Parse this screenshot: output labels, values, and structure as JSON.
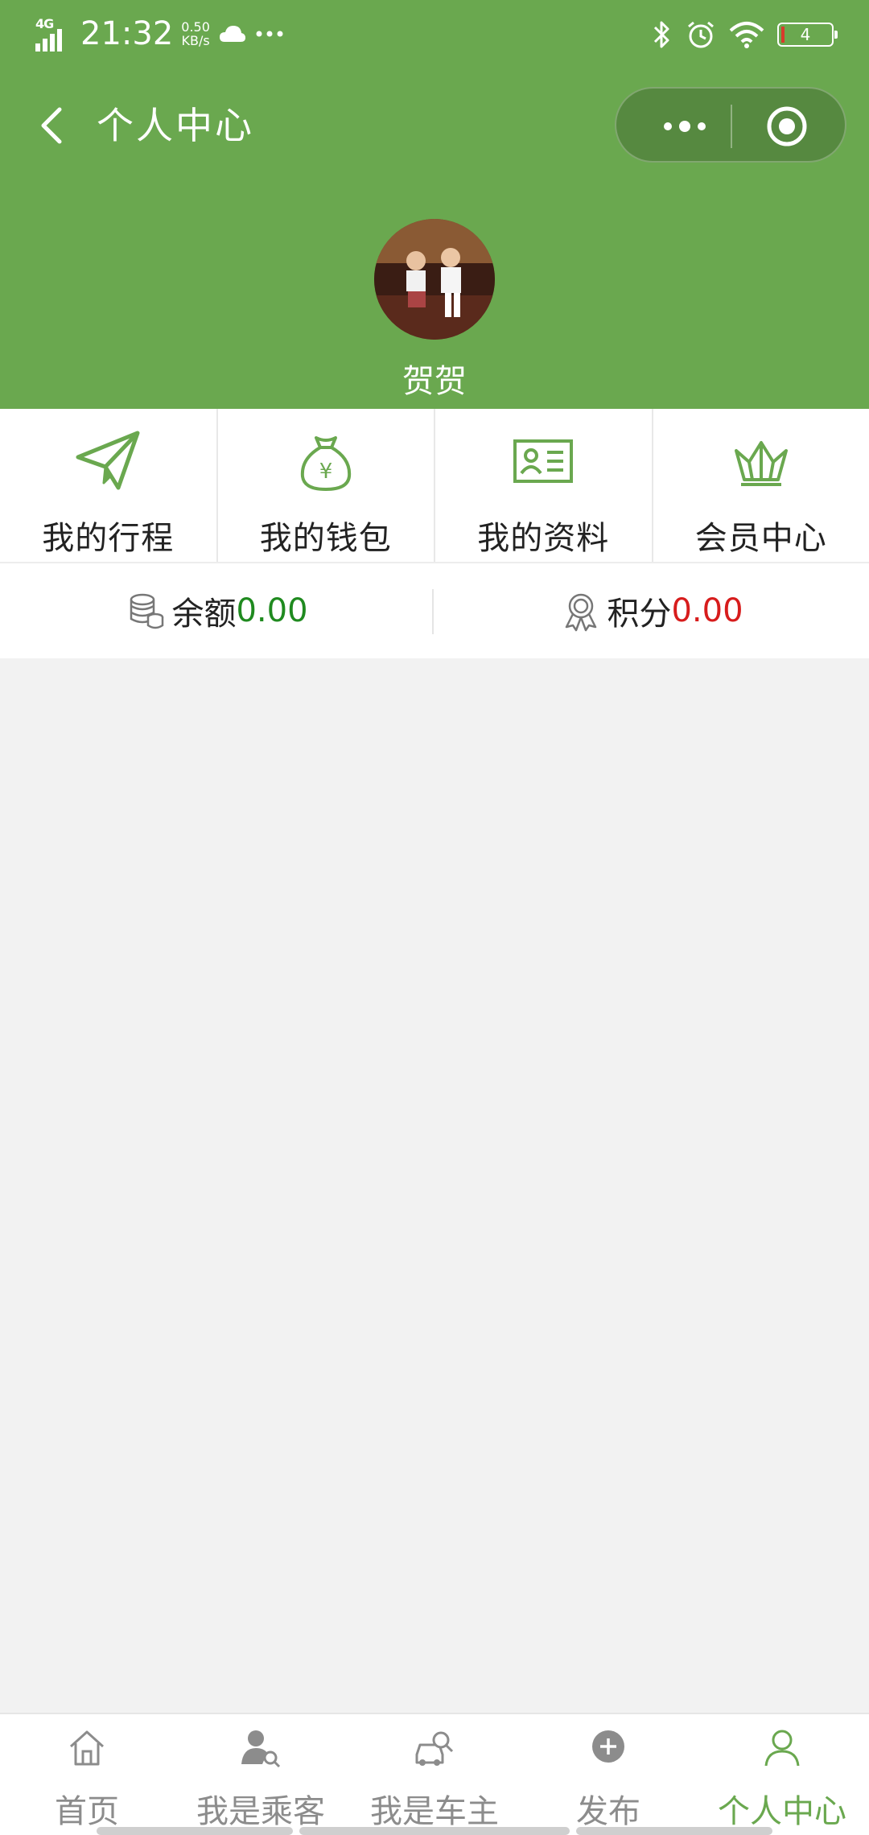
{
  "status_bar": {
    "network": "4G",
    "time": "21:32",
    "speed_value": "0.50",
    "speed_unit": "KB/s",
    "battery": "4",
    "icons": [
      "signal-icon",
      "cloud-icon",
      "more-dots-icon",
      "bluetooth-icon",
      "alarm-icon",
      "wifi-icon",
      "battery-icon"
    ]
  },
  "nav": {
    "title": "个人中心",
    "back_icon": "chevron-left-icon",
    "capsule_icons": [
      "more-dots-icon",
      "target-icon"
    ]
  },
  "profile": {
    "username": "贺贺",
    "avatar": "avatar-photo"
  },
  "menu": [
    {
      "label": "我的行程",
      "icon": "paper-plane-icon"
    },
    {
      "label": "我的钱包",
      "icon": "money-bag-icon"
    },
    {
      "label": "我的资料",
      "icon": "id-card-icon"
    },
    {
      "label": "会员中心",
      "icon": "crown-icon"
    }
  ],
  "balance": {
    "balance_label": "余额",
    "balance_value": "0.00",
    "points_label": "积分",
    "points_value": "0.00"
  },
  "tabbar": [
    {
      "label": "首页",
      "icon": "home-icon",
      "active": false
    },
    {
      "label": "我是乘客",
      "icon": "passenger-icon",
      "active": false
    },
    {
      "label": "我是车主",
      "icon": "car-owner-icon",
      "active": false
    },
    {
      "label": "发布",
      "icon": "plus-circle-icon",
      "active": false
    },
    {
      "label": "个人中心",
      "icon": "user-icon",
      "active": true
    }
  ],
  "colors": {
    "brand_green": "#6aa84f",
    "balance_value": "#1f8a1f",
    "points_value": "#d71c1c",
    "tab_inactive": "#8c8c8c",
    "page_bg": "#f2f2f2"
  }
}
